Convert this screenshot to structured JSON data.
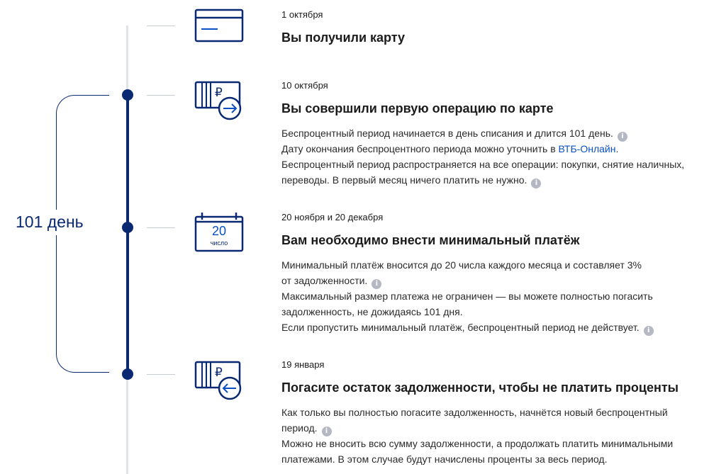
{
  "colors": {
    "primary": "#0a2973",
    "accent": "#0a4fc4",
    "muted": "#b4b8c2"
  },
  "period_label": "101 день",
  "steps": [
    {
      "icon": "card-icon",
      "date": "1 октября",
      "title": "Вы получили карту"
    },
    {
      "icon": "card-payment-out-icon",
      "date": "10 октября",
      "title": "Вы совершили первую операцию по карте",
      "line1": "Беспроцентный период начинается в день списания и длится 101 день.",
      "line2_prefix": "Дату окончания беспроцентного периода можно уточнить в ",
      "line2_link": "ВТБ-Онлайн",
      "line2_suffix": ".",
      "line3": "Беспроцентный период распространяется на все операции: покупки, снятие наличных,",
      "line4": "переводы. В первый месяц ничего платить не нужно."
    },
    {
      "icon": "calendar-icon",
      "calendar_day": "20",
      "calendar_caption": "число",
      "date": "20 ноября и 20 декабря",
      "title": "Вам необходимо внести минимальный платёж",
      "line1": "Минимальный платёж вносится до 20 числа каждого месяца и составляет 3%",
      "line2": "от задолженности.",
      "line3": "Максимальный размер платежа не ограничен — вы можете полностью погасить",
      "line4": "задолженность, не дожидаясь 101 дня.",
      "line5": "Если пропустить минимальный платёж, беспроцентный период не действует."
    },
    {
      "icon": "card-payment-in-icon",
      "date": "19 января",
      "title": "Погасите остаток задолженности, чтобы не платить проценты",
      "line1": "Как только вы полностью погасите задолженность, начнётся новый беспроцентный",
      "line2": "период.",
      "line3": "Можно не вносить всю сумму задолженности, а продолжать платить минимальными",
      "line4": "платежами. В этом случае будут начислены проценты за весь период."
    }
  ],
  "info_glyph": "i"
}
